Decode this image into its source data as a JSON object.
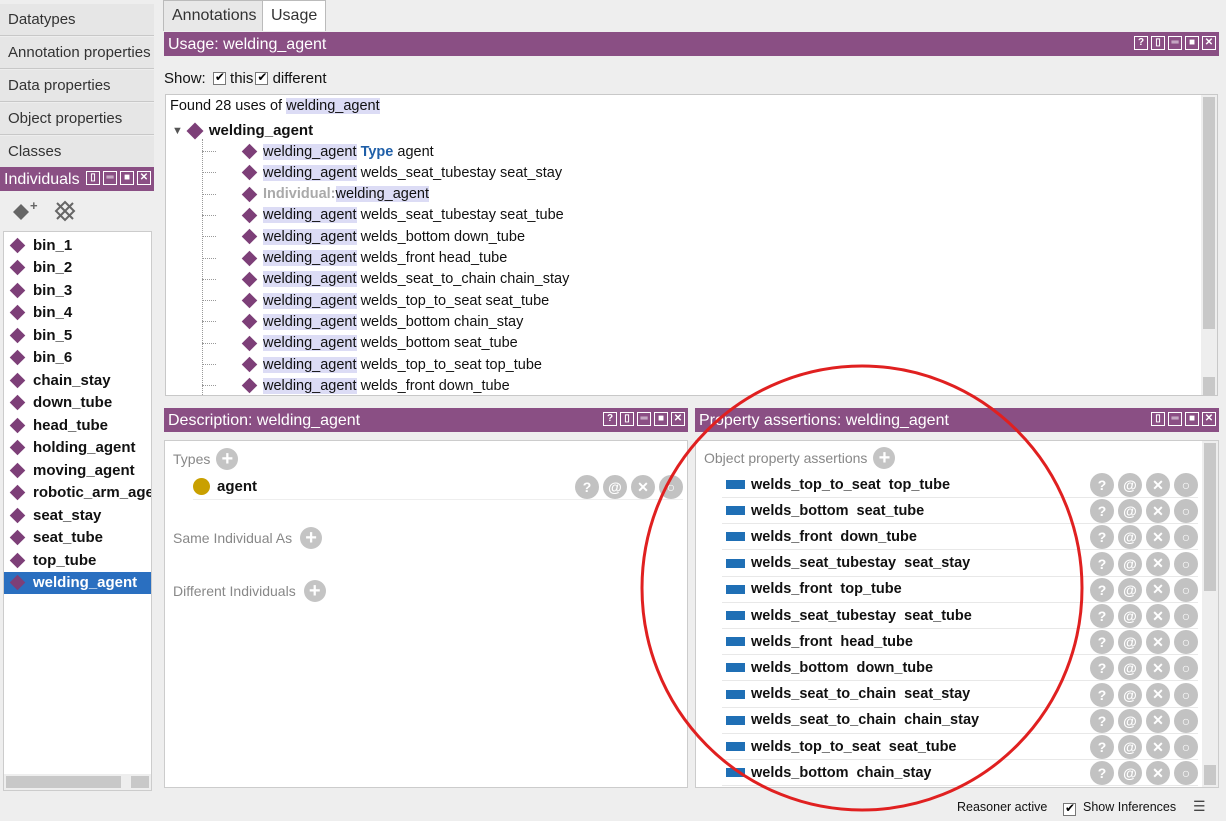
{
  "window_tabs": [
    "Datatypes",
    "Annotation properties",
    "Data properties",
    "Object properties",
    "Classes"
  ],
  "individuals_view": {
    "title": "Individuals",
    "items": [
      "bin_1",
      "bin_2",
      "bin_3",
      "bin_4",
      "bin_5",
      "bin_6",
      "chain_stay",
      "down_tube",
      "head_tube",
      "holding_agent",
      "moving_agent",
      "robotic_arm_agent",
      "seat_stay",
      "seat_tube",
      "top_tube",
      "welding_agent"
    ],
    "selected": "welding_agent"
  },
  "tabs": [
    "Annotations",
    "Usage"
  ],
  "active_tab": "Usage",
  "usage": {
    "title": "Usage: welding_agent",
    "show_label": "Show:",
    "this_label": "this",
    "different_label": "different",
    "found_prefix": "Found 28 uses of",
    "subject": "welding_agent",
    "root": "welding_agent",
    "rows": [
      {
        "subject": "welding_agent",
        "rest": "agent",
        "keyword": "Type"
      },
      {
        "subject": "welding_agent",
        "rest": "welds_seat_tubestay seat_stay"
      },
      {
        "subject": "welding_agent",
        "prefix": "Individual:"
      },
      {
        "subject": "welding_agent",
        "rest": "welds_seat_tubestay seat_tube"
      },
      {
        "subject": "welding_agent",
        "rest": "welds_bottom down_tube"
      },
      {
        "subject": "welding_agent",
        "rest": "welds_front head_tube"
      },
      {
        "subject": "welding_agent",
        "rest": "welds_seat_to_chain chain_stay"
      },
      {
        "subject": "welding_agent",
        "rest": "welds_top_to_seat seat_tube"
      },
      {
        "subject": "welding_agent",
        "rest": "welds_bottom chain_stay"
      },
      {
        "subject": "welding_agent",
        "rest": "welds_bottom seat_tube"
      },
      {
        "subject": "welding_agent",
        "rest": "welds_top_to_seat top_tube"
      },
      {
        "subject": "welding_agent",
        "rest": "welds_front down_tube"
      }
    ]
  },
  "description": {
    "title": "Description: welding_agent",
    "types_label": "Types",
    "type_value": "agent",
    "same_label": "Same Individual As",
    "different_label": "Different Individuals"
  },
  "property_assertions": {
    "title": "Property assertions: welding_agent",
    "section_label": "Object property assertions",
    "rows": [
      "welds_top_to_seat  top_tube",
      "welds_bottom  seat_tube",
      "welds_front  down_tube",
      "welds_seat_tubestay  seat_stay",
      "welds_front  top_tube",
      "welds_seat_tubestay  seat_tube",
      "welds_front  head_tube",
      "welds_bottom  down_tube",
      "welds_seat_to_chain  seat_stay",
      "welds_seat_to_chain  chain_stay",
      "welds_top_to_seat  seat_tube",
      "welds_bottom  chain_stay"
    ]
  },
  "status": {
    "reasoner": "Reasoner active",
    "show_inferences": "Show Inferences"
  },
  "colors": {
    "view_header": "#8a4f84",
    "individual_icon": "#7d3f78",
    "selection": "#2a6fc0",
    "property_icon": "#1f6fb5",
    "type_keyword": "#1f5fa8",
    "annotation_circle": "#e02020"
  }
}
